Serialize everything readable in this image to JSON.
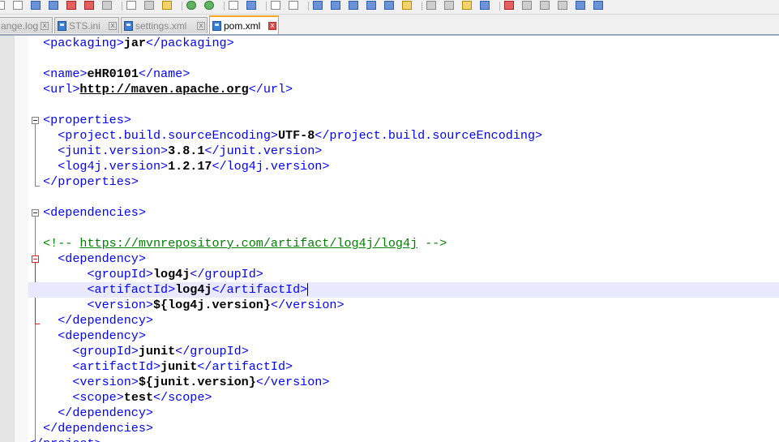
{
  "toolbar": {
    "icons": [
      "new-file-icon",
      "open-file-icon",
      "save-icon",
      "save-all-icon",
      "close-icon",
      "close-all-icon",
      "print-icon",
      "cut-icon",
      "copy-icon",
      "paste-icon",
      "undo-icon",
      "redo-icon",
      "find-icon",
      "replace-icon",
      "zoom-in-icon",
      "zoom-out-icon",
      "sync-vertical-icon",
      "sync-horizontal-icon",
      "word-wrap-icon",
      "show-all-chars-icon",
      "indent-guide-icon",
      "user-lang-icon",
      "doc-map-icon",
      "function-list-icon",
      "folder-workspace-icon",
      "monitoring-icon",
      "record-macro-icon",
      "stop-record-icon",
      "play-macro-icon",
      "run-macro-icon",
      "save-macro-icon",
      "spell-check-icon"
    ]
  },
  "tabs": [
    {
      "label": "ange.log",
      "active": false
    },
    {
      "label": "STS.ini",
      "active": false
    },
    {
      "label": "settings.xml",
      "active": false
    },
    {
      "label": "pom.xml",
      "active": true
    }
  ],
  "editor": {
    "lines": [
      [
        [
          "t",
          "  <packaging>"
        ],
        [
          "v",
          "jar"
        ],
        [
          "t",
          "</packaging>"
        ]
      ],
      [],
      [
        [
          "t",
          "  <name>"
        ],
        [
          "v",
          "eHR0101"
        ],
        [
          "t",
          "</name>"
        ]
      ],
      [
        [
          "t",
          "  <url>"
        ],
        [
          "u",
          "http://maven.apache.org"
        ],
        [
          "t",
          "</url>"
        ]
      ],
      [],
      [
        [
          "t",
          "  <properties>"
        ]
      ],
      [
        [
          "t",
          "    <project.build.sourceEncoding>"
        ],
        [
          "v",
          "UTF-8"
        ],
        [
          "t",
          "</project.build.sourceEncoding>"
        ]
      ],
      [
        [
          "t",
          "    <junit.version>"
        ],
        [
          "v",
          "3.8.1"
        ],
        [
          "t",
          "</junit.version>"
        ]
      ],
      [
        [
          "t",
          "    <log4j.version>"
        ],
        [
          "v",
          "1.2.17"
        ],
        [
          "t",
          "</log4j.version>"
        ]
      ],
      [
        [
          "t",
          "  </properties>"
        ]
      ],
      [],
      [
        [
          "t",
          "  <dependencies>"
        ]
      ],
      [],
      [
        [
          "c",
          "  <!-- "
        ],
        [
          "cu",
          "https://mvnrepository.com/artifact/log4j/log4j"
        ],
        [
          "c",
          " -->"
        ]
      ],
      [
        [
          "t",
          "    <dependency>"
        ]
      ],
      [
        [
          "t",
          "        <groupId>"
        ],
        [
          "v",
          "log4j"
        ],
        [
          "t",
          "</groupId>"
        ]
      ],
      [
        [
          "t",
          "        <artifactId>"
        ],
        [
          "v",
          "log4j"
        ],
        [
          "t",
          "</artifactId>"
        ]
      ],
      [
        [
          "t",
          "        <version>"
        ],
        [
          "v",
          "${log4j.version}"
        ],
        [
          "t",
          "</version>"
        ]
      ],
      [
        [
          "t",
          "    </dependency>"
        ]
      ],
      [
        [
          "t",
          "    <dependency>"
        ]
      ],
      [
        [
          "t",
          "      <groupId>"
        ],
        [
          "v",
          "junit"
        ],
        [
          "t",
          "</groupId>"
        ]
      ],
      [
        [
          "t",
          "      <artifactId>"
        ],
        [
          "v",
          "junit"
        ],
        [
          "t",
          "</artifactId>"
        ]
      ],
      [
        [
          "t",
          "      <version>"
        ],
        [
          "v",
          "${junit.version}"
        ],
        [
          "t",
          "</version>"
        ]
      ],
      [
        [
          "t",
          "      <scope>"
        ],
        [
          "v",
          "test"
        ],
        [
          "t",
          "</scope>"
        ]
      ],
      [
        [
          "t",
          "    </dependency>"
        ]
      ],
      [
        [
          "t",
          "  </dependencies>"
        ]
      ],
      [
        [
          "t",
          "</project>"
        ]
      ]
    ],
    "current_line": 16
  }
}
